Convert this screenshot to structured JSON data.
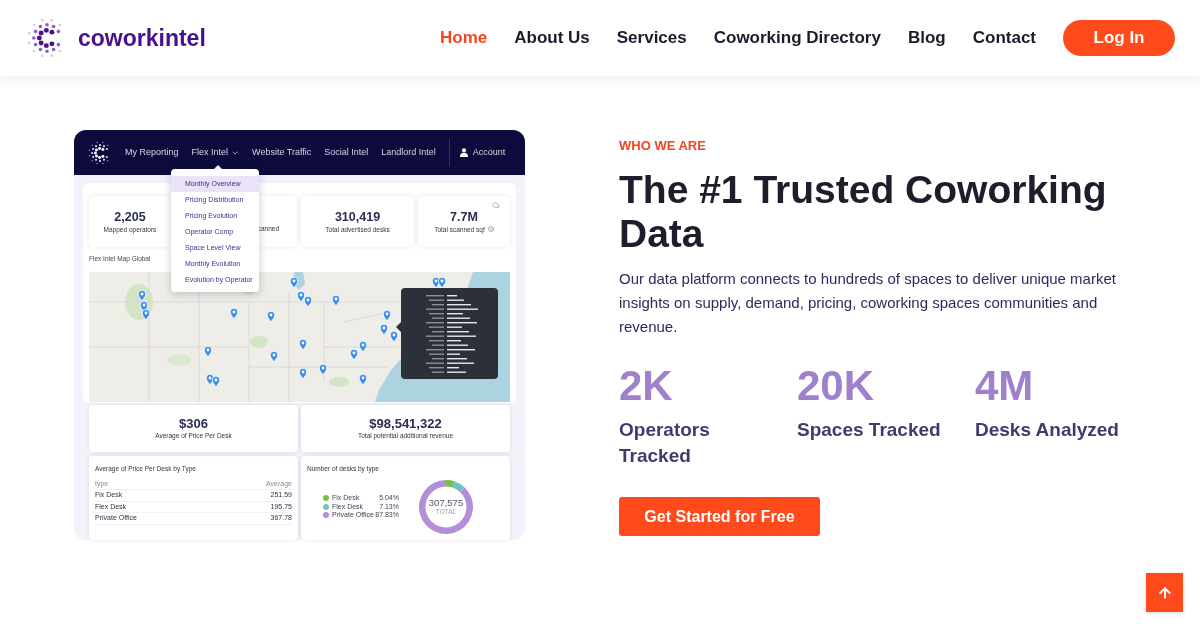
{
  "header": {
    "logo_text": "coworkintel",
    "nav": [
      {
        "label": "Home",
        "selected": true
      },
      {
        "label": "About Us",
        "selected": false
      },
      {
        "label": "Services",
        "selected": false
      },
      {
        "label": "Coworking Directory",
        "selected": false
      },
      {
        "label": "Blog",
        "selected": false
      },
      {
        "label": "Contact",
        "selected": false
      }
    ],
    "login_button": "Log In"
  },
  "dashboard": {
    "nav": [
      {
        "label": "My Reporting",
        "kind": "link"
      },
      {
        "label": "Flex Intel",
        "kind": "dropdown"
      },
      {
        "label": "Website Traffic",
        "kind": "link"
      },
      {
        "label": "Social Intel",
        "kind": "link"
      },
      {
        "label": "Landlord Intel",
        "kind": "link"
      },
      {
        "label": "Account",
        "kind": "account"
      }
    ],
    "menu": [
      {
        "label": "Monthly Overview",
        "selected": true
      },
      {
        "label": "Pricing Distribution",
        "selected": false
      },
      {
        "label": "Pricing Evolution",
        "selected": false
      },
      {
        "label": "Operator Comp",
        "selected": false
      },
      {
        "label": "Space Level View",
        "selected": false
      },
      {
        "label": "Monthly Evolution",
        "selected": false
      },
      {
        "label": "Evolution by Operator",
        "selected": false
      }
    ],
    "stats": [
      {
        "kind": "metric",
        "value": "2,205",
        "label": "Mapped operators"
      },
      {
        "kind": "covered",
        "label": "canned"
      },
      {
        "kind": "metric",
        "value": "310,419",
        "label": "Total advertised desks"
      },
      {
        "kind": "metric_info",
        "value": "7.7M",
        "label": "Total scanned sqf"
      }
    ],
    "map_title": "Flex Intel Map Global",
    "kpis": [
      {
        "value": "$306",
        "label": "Average of Price Per Desk"
      },
      {
        "value": "$98,541,322",
        "label": "Total potential additional revenue"
      }
    ],
    "price_table": {
      "title": "Average of Price Per Desk by Type",
      "columns": [
        "type",
        "Average"
      ],
      "rows": [
        [
          "Fix Desk",
          "251.59"
        ],
        [
          "Flex Desk",
          "195.75"
        ],
        [
          "Private Office",
          "367.78"
        ]
      ]
    },
    "desks_by_type": {
      "chart_data": {
        "type": "donut",
        "title": "Number of desks by type",
        "categories": [
          "Fix Desk",
          "Flex Desk",
          "Private Office"
        ],
        "values": [
          5.04,
          7.13,
          87.83
        ],
        "legend": "left"
      },
      "legend": [
        {
          "share": "5.04%",
          "color": "#76c043"
        },
        {
          "share": "7.13%",
          "color": "#71c2c4"
        },
        {
          "share": "87.83%",
          "color": "#b28fd8"
        }
      ],
      "total": "307,575",
      "total_label": "TOTAL"
    }
  },
  "intro": {
    "eyebrow": "WHO WE ARE",
    "heading": "The #1 Trusted Coworking Data",
    "text": "Our data platform connects to hundreds of spaces to deliver unique market insights on supply, demand, pricing, coworking spaces communities and revenue.",
    "stats": [
      {
        "value": "2K",
        "label": "Operators Tracked"
      },
      {
        "value": "20K",
        "label": "Spaces Tracked"
      },
      {
        "value": "4M",
        "label": "Desks Analyzed"
      }
    ],
    "cta": "Get Started for Free"
  }
}
